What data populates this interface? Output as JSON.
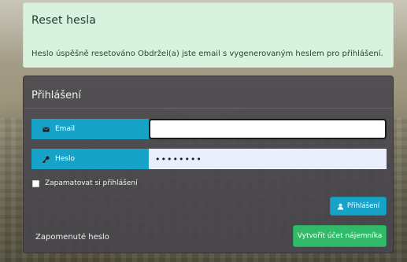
{
  "alert": {
    "title": "Reset hesla",
    "message": "Heslo úspěšně resetováno Obdržel(a) jste email s vygenerovaným heslem pro přihlášení."
  },
  "login": {
    "title": "Přihlášení",
    "email_label": "Email",
    "email_value": "",
    "password_label": "Heslo",
    "password_value": "••••••••",
    "remember_label": "Zapamatovat si přihlášení",
    "remember_checked": false,
    "submit_label": "Přihlášení",
    "forgot_label": "Zapomenuté heslo",
    "create_account_label": "Vytvořit účet nájemníka"
  },
  "icons": {
    "email": "envelope-icon",
    "password": "key-icon",
    "submit": "user-icon"
  },
  "colors": {
    "accent": "#17a2c7",
    "success_alert_bg": "#d9f1df",
    "create_button": "#33b96a",
    "panel_bg": "#48464c"
  }
}
